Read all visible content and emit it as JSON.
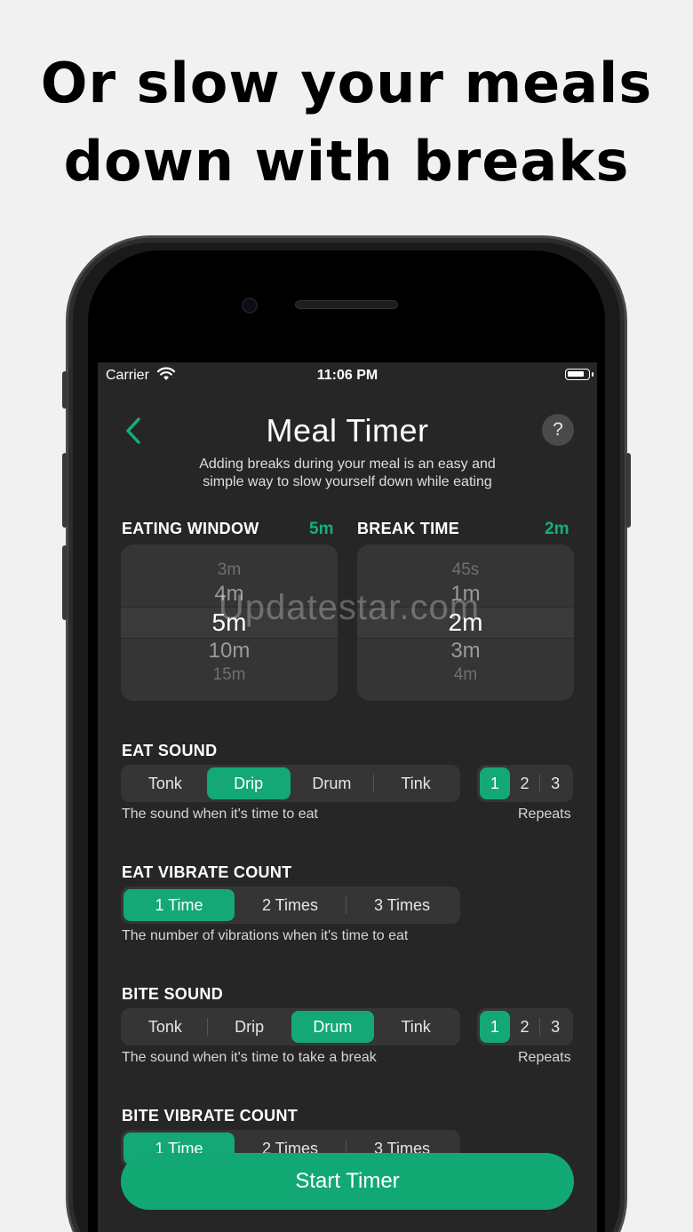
{
  "headline": {
    "line1": "Or slow your meals",
    "line2": "down with breaks"
  },
  "status_bar": {
    "carrier": "Carrier",
    "time": "11:06 PM"
  },
  "nav": {
    "title": "Meal Timer",
    "help_label": "?",
    "subtitle_line1": "Adding breaks during your meal is an easy and",
    "subtitle_line2": "simple way to slow yourself down while eating"
  },
  "eating_window": {
    "label": "EATING WINDOW",
    "value": "5m",
    "options": [
      "3m",
      "4m",
      "5m",
      "10m",
      "15m"
    ]
  },
  "break_time": {
    "label": "BREAK TIME",
    "value": "2m",
    "options": [
      "45s",
      "1m",
      "2m",
      "3m",
      "4m"
    ]
  },
  "eat_sound": {
    "label": "EAT SOUND",
    "options": [
      "Tonk",
      "Drip",
      "Drum",
      "Tink"
    ],
    "selected": "Drip",
    "hint": "The sound when it's time to eat",
    "repeats": [
      "1",
      "2",
      "3"
    ],
    "repeats_selected": "1",
    "repeats_label": "Repeats"
  },
  "eat_vibrate": {
    "label": "EAT VIBRATE COUNT",
    "options": [
      "1 Time",
      "2 Times",
      "3 Times"
    ],
    "selected": "1 Time",
    "hint": "The number of vibrations when it's time to eat"
  },
  "bite_sound": {
    "label": "BITE SOUND",
    "options": [
      "Tonk",
      "Drip",
      "Drum",
      "Tink"
    ],
    "selected": "Drum",
    "hint": "The sound when it's time to take a break",
    "repeats": [
      "1",
      "2",
      "3"
    ],
    "repeats_selected": "1",
    "repeats_label": "Repeats"
  },
  "bite_vibrate": {
    "label": "BITE VIBRATE COUNT",
    "options": [
      "1 Time",
      "2 Times",
      "3 Times"
    ],
    "selected": "1 Time"
  },
  "start_button": "Start Timer",
  "watermark": "Updatestar.com",
  "colors": {
    "accent": "#13a875",
    "screen_bg": "#262626",
    "control_bg": "#353535",
    "page_bg": "#f1f1f1"
  },
  "icons": {
    "back": "chevron-left-icon",
    "wifi": "wifi-icon",
    "battery": "battery-icon",
    "help": "question-mark-icon"
  }
}
